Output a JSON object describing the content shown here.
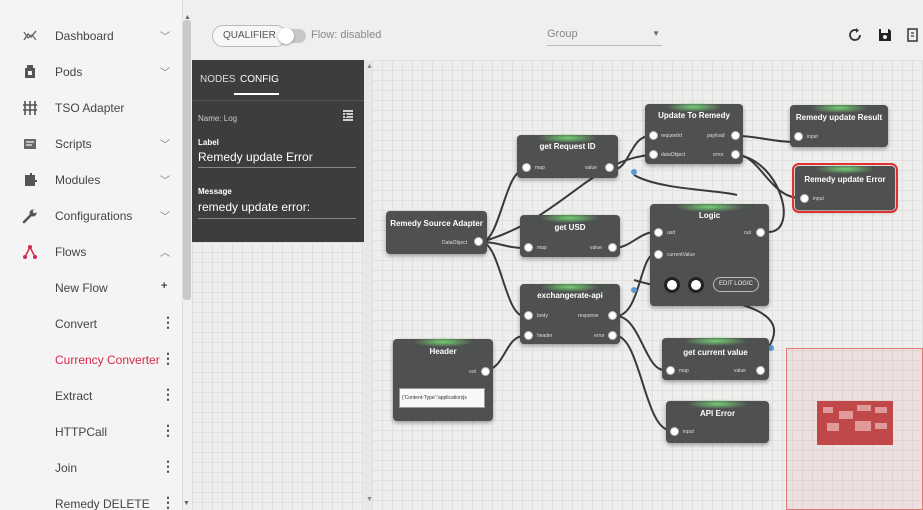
{
  "sidebar": {
    "items": [
      {
        "label": "Dashboard",
        "icon": "dashboard-icon",
        "expand": "chevron-down"
      },
      {
        "label": "Pods",
        "icon": "pods-icon",
        "expand": "chevron-down"
      },
      {
        "label": "TSO Adapter",
        "icon": "adapter-icon",
        "expand": ""
      },
      {
        "label": "Scripts",
        "icon": "scripts-icon",
        "expand": "chevron-down"
      },
      {
        "label": "Modules",
        "icon": "modules-icon",
        "expand": "chevron-down"
      },
      {
        "label": "Configurations",
        "icon": "wrench-icon",
        "expand": "chevron-down"
      },
      {
        "label": "Flows",
        "icon": "flows-icon",
        "expand": "chevron-up"
      }
    ],
    "flows": [
      {
        "label": "New Flow"
      },
      {
        "label": "Convert"
      },
      {
        "label": "Currency Converter"
      },
      {
        "label": "Extract"
      },
      {
        "label": "HTTPCall"
      },
      {
        "label": "Join"
      },
      {
        "label": "Remedy DELETE"
      }
    ]
  },
  "toolbar": {
    "qualifier_label": "QUALIFIER",
    "flow_toggle_label": "Flow: disabled",
    "group_placeholder": "Group"
  },
  "panel": {
    "tabs": [
      "NODES",
      "CONFIG"
    ],
    "name_label": "Name: Log",
    "label_label": "Label",
    "label_value": "Remedy update Error",
    "message_label": "Message",
    "message_value": "remedy update error:"
  },
  "nodes": {
    "remedy_source": {
      "title": "Remedy Source Adapter",
      "out": "DataObject"
    },
    "get_request_id": {
      "title": "get Request ID",
      "in": "map",
      "out": "value"
    },
    "update_remedy": {
      "title": "Update To Remedy",
      "in1": "requestId",
      "in2": "dataObject",
      "out1": "payload",
      "out2": "error"
    },
    "remedy_result": {
      "title": "Remedy update Result",
      "in": "input"
    },
    "remedy_error": {
      "title": "Remedy update Error",
      "in": "input"
    },
    "get_usd": {
      "title": "get USD",
      "in": "map",
      "out": "value"
    },
    "logic": {
      "title": "Logic",
      "in1": "usd",
      "in2": "currentValue",
      "out": "out",
      "button": "EDIT LOGIC"
    },
    "exchangerate": {
      "title": "exchangerate-api",
      "in1": "body",
      "in2": "header",
      "out1": "response",
      "out2": "error"
    },
    "header": {
      "title": "Header",
      "out": "out",
      "content": "{'Content-Type':'application/js"
    },
    "get_current": {
      "title": "get current value",
      "in": "map",
      "out": "value"
    },
    "api_error": {
      "title": "API Error",
      "in": "input"
    }
  }
}
